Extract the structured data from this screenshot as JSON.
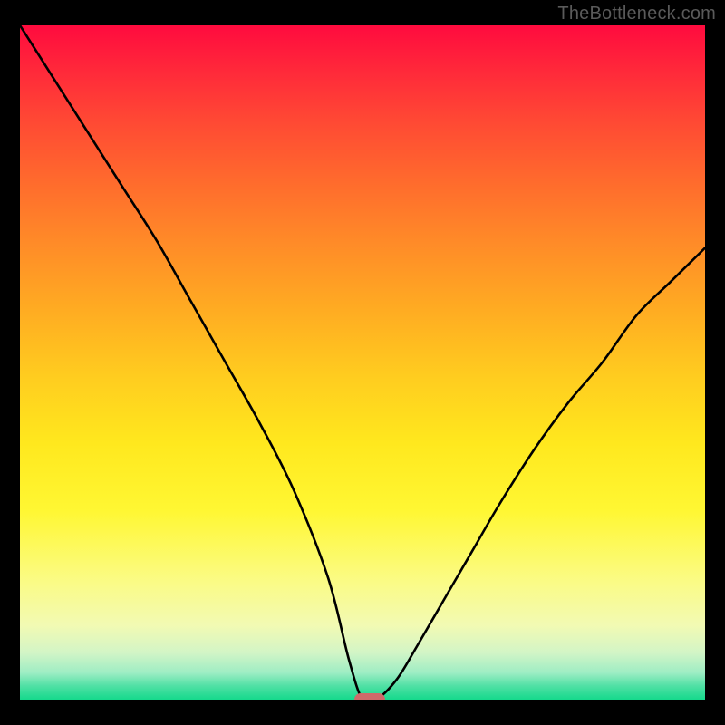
{
  "watermark": "TheBottleneck.com",
  "chart_data": {
    "type": "line",
    "title": "",
    "xlabel": "",
    "ylabel": "",
    "xlim": [
      0,
      100
    ],
    "ylim": [
      0,
      100
    ],
    "grid": false,
    "series": [
      {
        "name": "bottleneck-curve",
        "x": [
          0,
          5,
          10,
          15,
          20,
          25,
          30,
          35,
          40,
          45,
          48,
          50,
          52,
          55,
          58,
          62,
          66,
          70,
          75,
          80,
          85,
          90,
          95,
          100
        ],
        "y": [
          100,
          92,
          84,
          76,
          68,
          59,
          50,
          41,
          31,
          18,
          6,
          0,
          0,
          3,
          8,
          15,
          22,
          29,
          37,
          44,
          50,
          57,
          62,
          67
        ]
      }
    ],
    "marker": {
      "x": 51,
      "y": 0
    },
    "gradient_stops": [
      {
        "pos": 0,
        "color": "#ff0b3e"
      },
      {
        "pos": 50,
        "color": "#ffe81e"
      },
      {
        "pos": 100,
        "color": "#15d98c"
      }
    ]
  }
}
